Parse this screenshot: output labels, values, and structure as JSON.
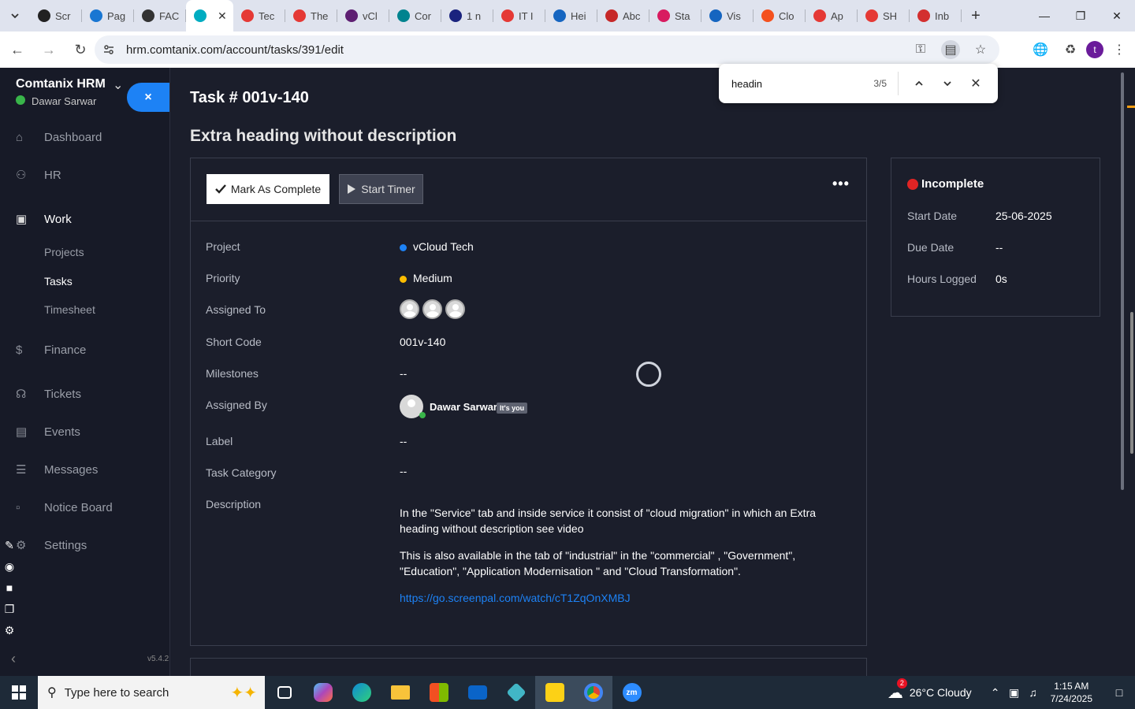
{
  "browser": {
    "tabs": [
      {
        "label": "Scr",
        "color": "#222"
      },
      {
        "label": "Pag",
        "color": "#1976d2"
      },
      {
        "label": "FAC",
        "color": "#333"
      },
      {
        "label": "",
        "color": "#00acc1",
        "active": true
      },
      {
        "label": "Tec",
        "color": "#e53935"
      },
      {
        "label": "The",
        "color": "#e53935"
      },
      {
        "label": "vCl",
        "color": "#5e1f72"
      },
      {
        "label": "Cor",
        "color": "#00838f"
      },
      {
        "label": "1 n",
        "color": "#1a237e"
      },
      {
        "label": "IT I",
        "color": "#e53935"
      },
      {
        "label": "Hei",
        "color": "#1565c0"
      },
      {
        "label": "Abc",
        "color": "#c62828"
      },
      {
        "label": "Sta",
        "color": "#d81b60"
      },
      {
        "label": "Vis",
        "color": "#1565c0"
      },
      {
        "label": "Clo",
        "color": "#f4511e"
      },
      {
        "label": "Ap",
        "color": "#e53935"
      },
      {
        "label": "SH",
        "color": "#e53935"
      },
      {
        "label": "Inb",
        "color": "#d32f2f"
      }
    ],
    "url": "hrm.comtanix.com/account/tasks/391/edit",
    "find": {
      "query": "headin",
      "count": "3/5"
    }
  },
  "sidebar": {
    "brand": "Comtanix HRM",
    "user": "Dawar Sarwar",
    "close_label": "×",
    "menu": {
      "dashboard": "Dashboard",
      "hr": "HR",
      "work": "Work",
      "projects": "Projects",
      "tasks": "Tasks",
      "timesheet": "Timesheet",
      "finance": "Finance",
      "tickets": "Tickets",
      "events": "Events",
      "messages": "Messages",
      "notice_board": "Notice Board",
      "settings": "Settings"
    },
    "version": "v5.4.2"
  },
  "task": {
    "number": "Task # 001v-140",
    "heading": "Extra heading without description",
    "mark_complete": "Mark As Complete",
    "start_timer": "Start Timer",
    "labels": {
      "project": "Project",
      "priority": "Priority",
      "assigned_to": "Assigned To",
      "short_code": "Short Code",
      "milestones": "Milestones",
      "assigned_by": "Assigned By",
      "label": "Label",
      "task_category": "Task Category",
      "description": "Description"
    },
    "values": {
      "project": "vCloud Tech",
      "priority": "Medium",
      "short_code": "001v-140",
      "milestones": "--",
      "assigned_by": "Dawar Sarwar",
      "its_you": "It's you",
      "label": "--",
      "task_category": "--"
    },
    "colors": {
      "project": "#1d82f5",
      "priority": "#fcbd01"
    },
    "description": {
      "p1": "In the \"Service\" tab and inside service it consist of \"cloud migration\" in which an Extra heading without description see video",
      "p2": "This is also available in the tab of \"industrial\" in the \"commercial\" , \"Government\", \"Education\", \"Application Modernisation \" and \"Cloud Transformation\".",
      "link": "https://go.screenpal.com/watch/cT1ZqOnXMBJ"
    }
  },
  "status_card": {
    "status": "Incomplete",
    "start_date_label": "Start Date",
    "start_date": "25-06-2025",
    "due_date_label": "Due Date",
    "due_date": "--",
    "hours_label": "Hours Logged",
    "hours": "0s"
  },
  "taskbar": {
    "search_placeholder": "Type here to search",
    "weather": "26°C  Cloudy",
    "weather_badge": "2",
    "time": "1:15 AM",
    "date": "7/24/2025"
  }
}
